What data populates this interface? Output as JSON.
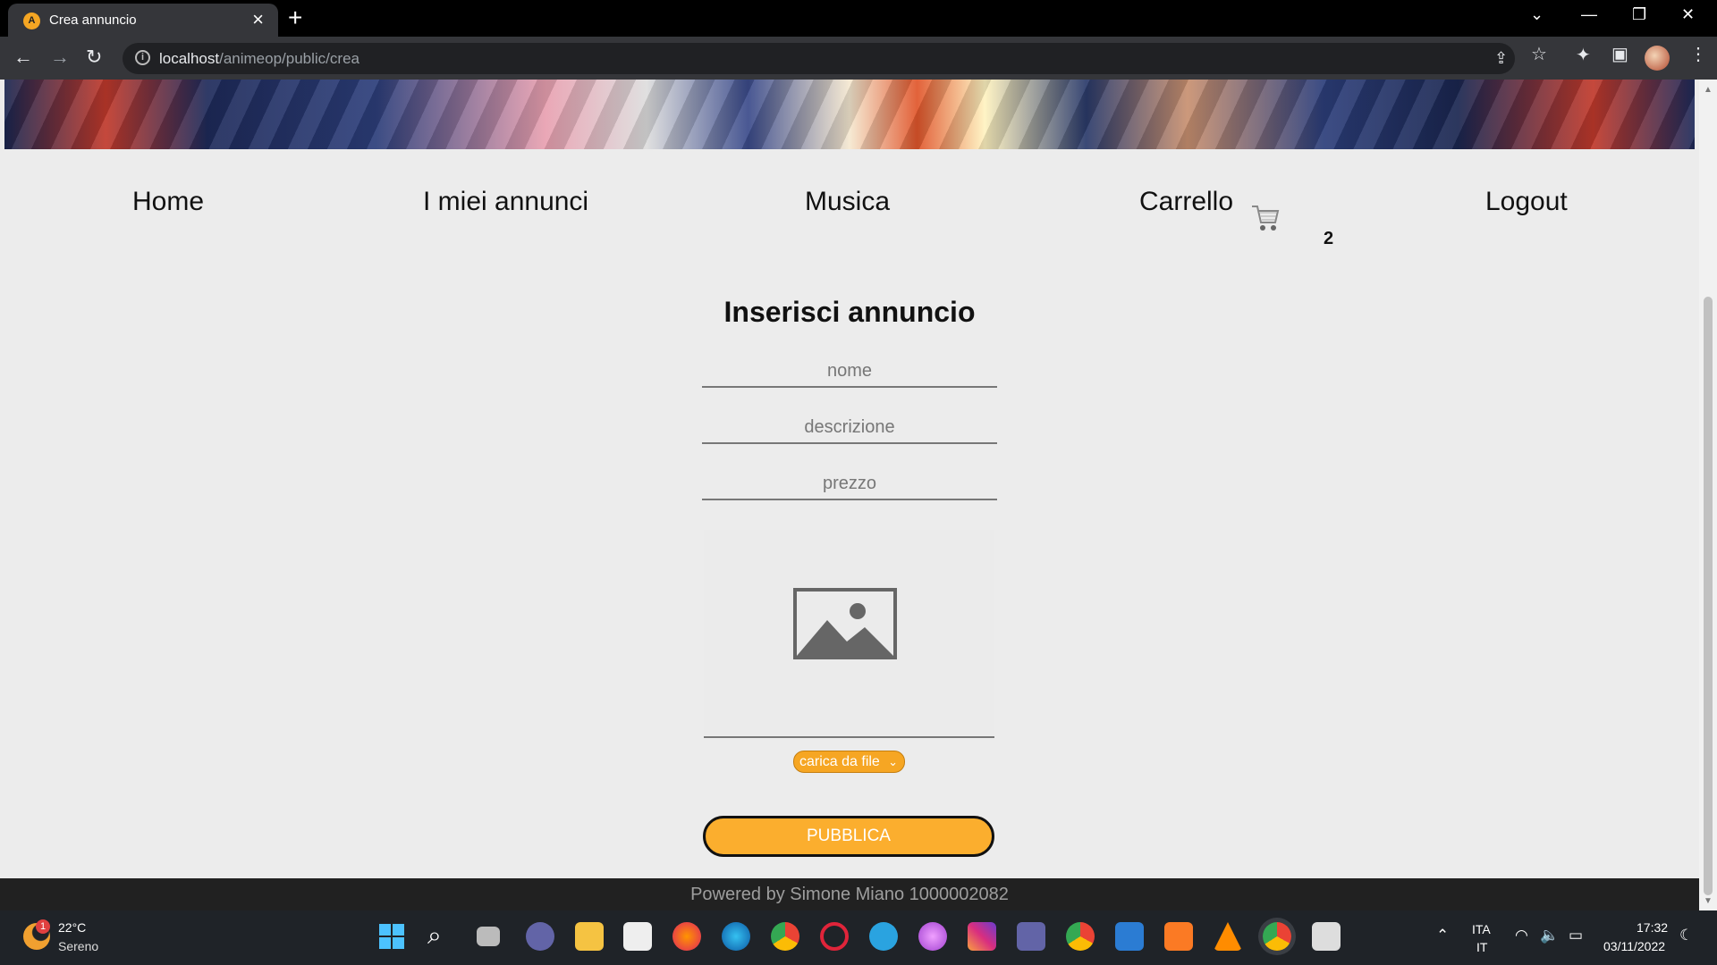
{
  "browser": {
    "tab_title": "Crea annuncio",
    "tab_favicon": "A",
    "url_host": "localhost",
    "url_path": "/animeop/public/crea"
  },
  "nav": {
    "items": [
      "Home",
      "I miei annunci",
      "Musica",
      "Carrello",
      "Logout"
    ],
    "cart_count": "2"
  },
  "form": {
    "title": "Inserisci annuncio",
    "name_placeholder": "nome",
    "description_placeholder": "descrizione",
    "price_placeholder": "prezzo",
    "upload_option": "carica da file",
    "submit_label": "PUBBLICA"
  },
  "footer": {
    "text": "Powered by Simone Miano 1000002082"
  },
  "taskbar": {
    "weather_badge": "1",
    "weather_temp": "22°C",
    "weather_desc": "Sereno",
    "lang_line1": "ITA",
    "lang_line2": "IT",
    "time": "17:32",
    "date": "03/11/2022"
  },
  "colors": {
    "accent": "#fbae2e",
    "footer_bg": "#212121",
    "page_bg": "#ececec"
  }
}
